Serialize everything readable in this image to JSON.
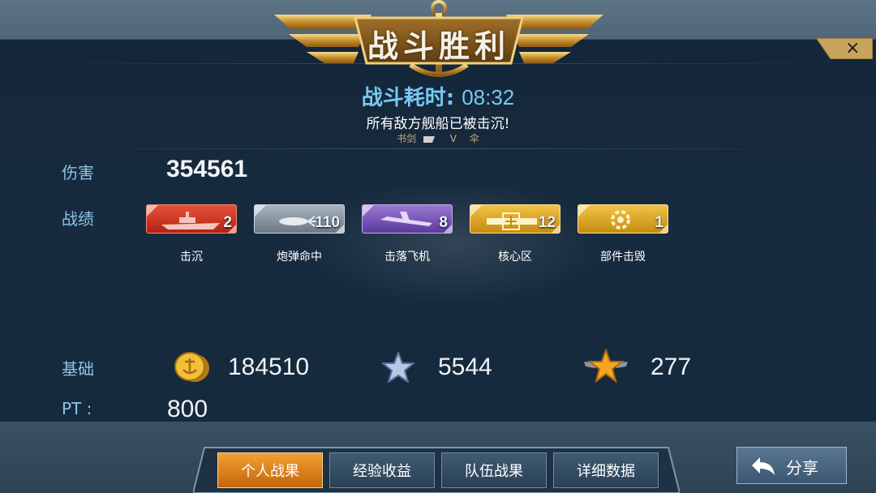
{
  "header": {
    "title": "战斗胜利",
    "close_glyph": "×",
    "time_label": "战斗耗时:",
    "time_value": "08:32",
    "subtitle": "所有敌方舰船已被击沉!",
    "players": [
      "书剑",
      "V",
      "伞"
    ]
  },
  "damage": {
    "label": "伤害",
    "value": "354561"
  },
  "record": {
    "label": "战绩",
    "medals": [
      {
        "name": "击沉",
        "count": "2",
        "color": "#d63a22",
        "icon": "warship-icon"
      },
      {
        "name": "炮弹命中",
        "count": "110",
        "color": "#8e9aa6",
        "icon": "shell-icon"
      },
      {
        "name": "击落飞机",
        "count": "8",
        "color": "#7a57b8",
        "icon": "aircraft-icon"
      },
      {
        "name": "核心区",
        "count": "12",
        "color": "#e3a81c",
        "icon": "core-zone-icon"
      },
      {
        "name": "部件击毁",
        "count": "1",
        "color": "#e3a81c",
        "icon": "gear-icon"
      }
    ]
  },
  "base": {
    "label": "基础",
    "gold": {
      "icon": "gold-coin-icon",
      "value": "184510"
    },
    "exp": {
      "icon": "silver-star-icon",
      "value": "5544"
    },
    "merit": {
      "icon": "gold-star-wings-icon",
      "value": "277"
    }
  },
  "pt": {
    "label": "PT :",
    "value": "800"
  },
  "tabs": [
    {
      "label": "个人战果",
      "active": true
    },
    {
      "label": "经验收益",
      "active": false
    },
    {
      "label": "队伍战果",
      "active": false
    },
    {
      "label": "详细数据",
      "active": false
    }
  ],
  "share": {
    "label": "分享",
    "icon": "back-arrow-icon"
  },
  "colors": {
    "accent_blue": "#79c8f3",
    "label_blue": "#8fc3e6",
    "tab_active": "#e8891f"
  }
}
